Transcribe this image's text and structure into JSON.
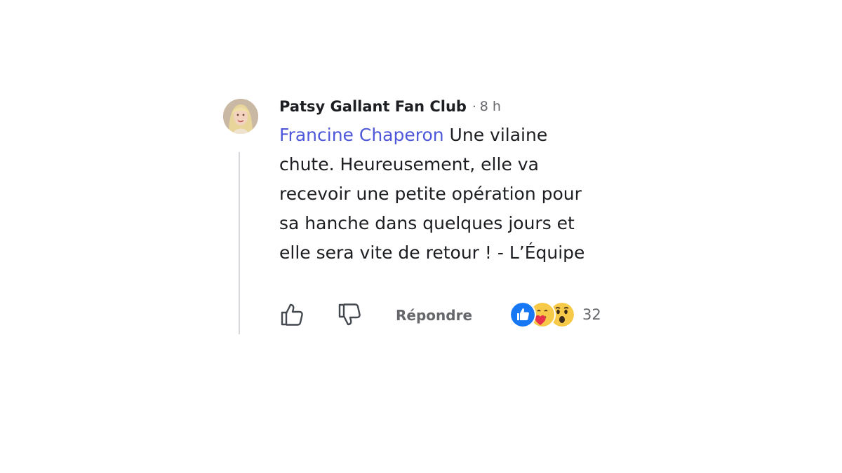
{
  "comment": {
    "author": "Patsy Gallant Fan Club",
    "separator": "·",
    "time": "8 h",
    "mention": "Francine Chaperon",
    "body": " Une vilaine chute. Heureusement, elle va recevoir une petite opération pour sa hanche dans quelques jours et elle sera vite de retour ! - L’Équipe"
  },
  "actions": {
    "like_icon": "thumbs-up-icon",
    "dislike_icon": "thumbs-down-icon",
    "reply_label": "Répondre"
  },
  "reactions": {
    "icons": [
      "like-reaction-icon",
      "care-reaction-icon",
      "wow-reaction-icon"
    ],
    "count": "32"
  },
  "colors": {
    "mention": "#4e58d9",
    "like_blue": "#1877f2",
    "emoji_yellow": "#f7c948",
    "secondary_text": "#65676b"
  }
}
